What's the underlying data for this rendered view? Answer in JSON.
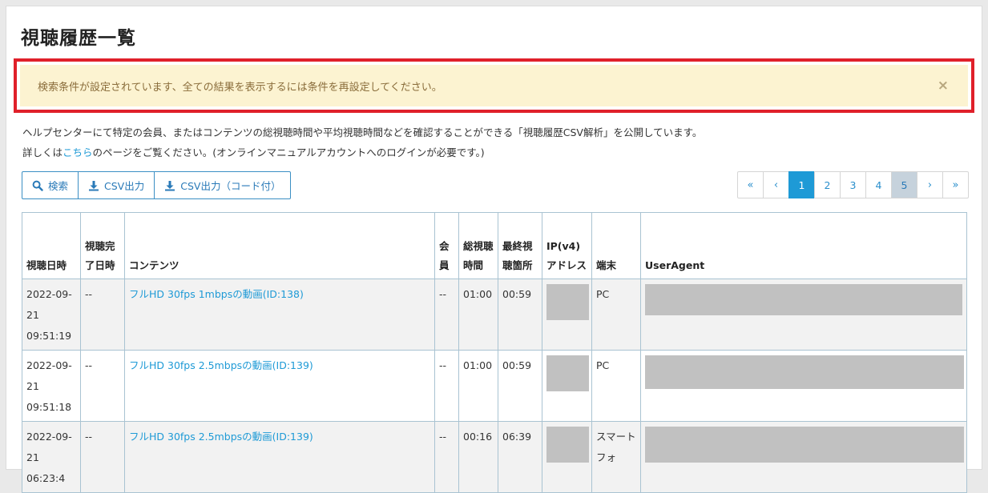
{
  "page": {
    "title": "視聴履歴一覧"
  },
  "alert": {
    "message": "検索条件が設定されています、全ての結果を表示するには条件を再設定してください。",
    "close": "×"
  },
  "help": {
    "line1": "ヘルプセンターにて特定の会員、またはコンテンツの総視聴時間や平均視聴時間などを確認することができる「視聴履歴CSV解析」を公開しています。",
    "line2_prefix": "詳しくは",
    "line2_link": "こちら",
    "line2_suffix": "のページをご覧ください。(オンラインマニュアルアカウントへのログインが必要です。)"
  },
  "toolbar": {
    "search_label": "検索",
    "csv_label": "CSV出力",
    "csv_code_label": "CSV出力（コード付）"
  },
  "pager": {
    "first": "«",
    "prev": "‹",
    "pages": [
      "1",
      "2",
      "3",
      "4",
      "5"
    ],
    "current": "1",
    "next": "›",
    "last": "»"
  },
  "table": {
    "headers": {
      "viewed_at": "視聴日時",
      "completed_at": "視聴完了日時",
      "content": "コンテンツ",
      "member": "会員",
      "total_time": "総視聴時間",
      "last_position": "最終視聴箇所",
      "ip": "IP(v4)アドレス",
      "device": "端末",
      "user_agent": "UserAgent"
    },
    "rows": [
      {
        "viewed_at": "2022-09-21 09:51:19",
        "completed_at": "--",
        "content": "フルHD 30fps 1mbpsの動画(ID:138)",
        "member": "--",
        "total_time": "01:00",
        "last_position": "00:59",
        "device": "PC"
      },
      {
        "viewed_at": "2022-09-21 09:51:18",
        "completed_at": "--",
        "content": "フルHD 30fps 2.5mbpsの動画(ID:139)",
        "member": "--",
        "total_time": "01:00",
        "last_position": "00:59",
        "device": "PC"
      },
      {
        "viewed_at": "2022-09-21 06:23:4",
        "completed_at": "--",
        "content": "フルHD 30fps 2.5mbpsの動画(ID:139)",
        "member": "--",
        "total_time": "00:16",
        "last_position": "06:39",
        "device": "スマートフォ"
      }
    ]
  },
  "icons": {
    "search": "search-icon",
    "download": "download-icon"
  },
  "colors": {
    "accent": "#1e9ad6",
    "alert_bg": "#fcf3d1",
    "alert_text": "#8a6d3b",
    "highlight_border": "#e0202a",
    "masked": "#c1c1c1"
  }
}
